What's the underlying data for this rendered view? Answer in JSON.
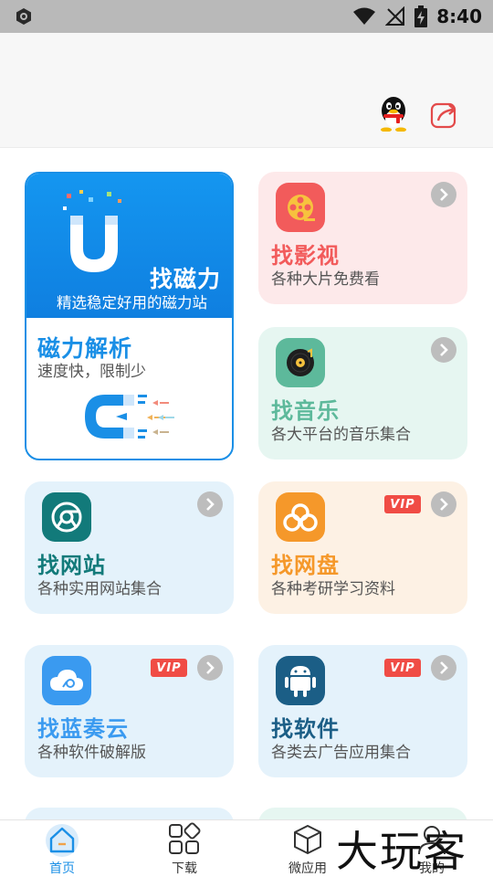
{
  "status_bar": {
    "time": "8:40"
  },
  "cards": {
    "magnet": {
      "title": "找磁力",
      "subtitle": "精选稳定好用的磁力站",
      "section_title": "磁力解析",
      "section_subtitle": "速度快，限制少"
    },
    "video": {
      "title": "找影视",
      "subtitle": "各种大片免费看",
      "title_color": "#f25b5b"
    },
    "music": {
      "title": "找音乐",
      "subtitle": "各大平台的音乐集合",
      "title_color": "#5db99b"
    },
    "website": {
      "title": "找网站",
      "subtitle": "各种实用网站集合",
      "title_color": "#127a7a"
    },
    "netdisk": {
      "title": "找网盘",
      "subtitle": "各种考研学习资料",
      "vip": "VIP",
      "title_color": "#f5982a"
    },
    "lanzou": {
      "title": "找蓝奏云",
      "subtitle": "各种软件破解版",
      "vip": "VIP",
      "title_color": "#3a9af0"
    },
    "software": {
      "title": "找软件",
      "subtitle": "各类去广告应用集合",
      "vip": "VIP",
      "title_color": "#1b5e86"
    }
  },
  "tabs": [
    {
      "label": "首页",
      "icon": "home-icon",
      "active": true
    },
    {
      "label": "下载",
      "icon": "grid-icon"
    },
    {
      "label": "微应用",
      "icon": "cube-icon"
    },
    {
      "label": "我的",
      "icon": "user-icon"
    }
  ],
  "watermark": "大玩客",
  "colors": {
    "accent": "#1a8fe6",
    "arrow": "#bdbdbd",
    "vip": "#f04c45"
  }
}
